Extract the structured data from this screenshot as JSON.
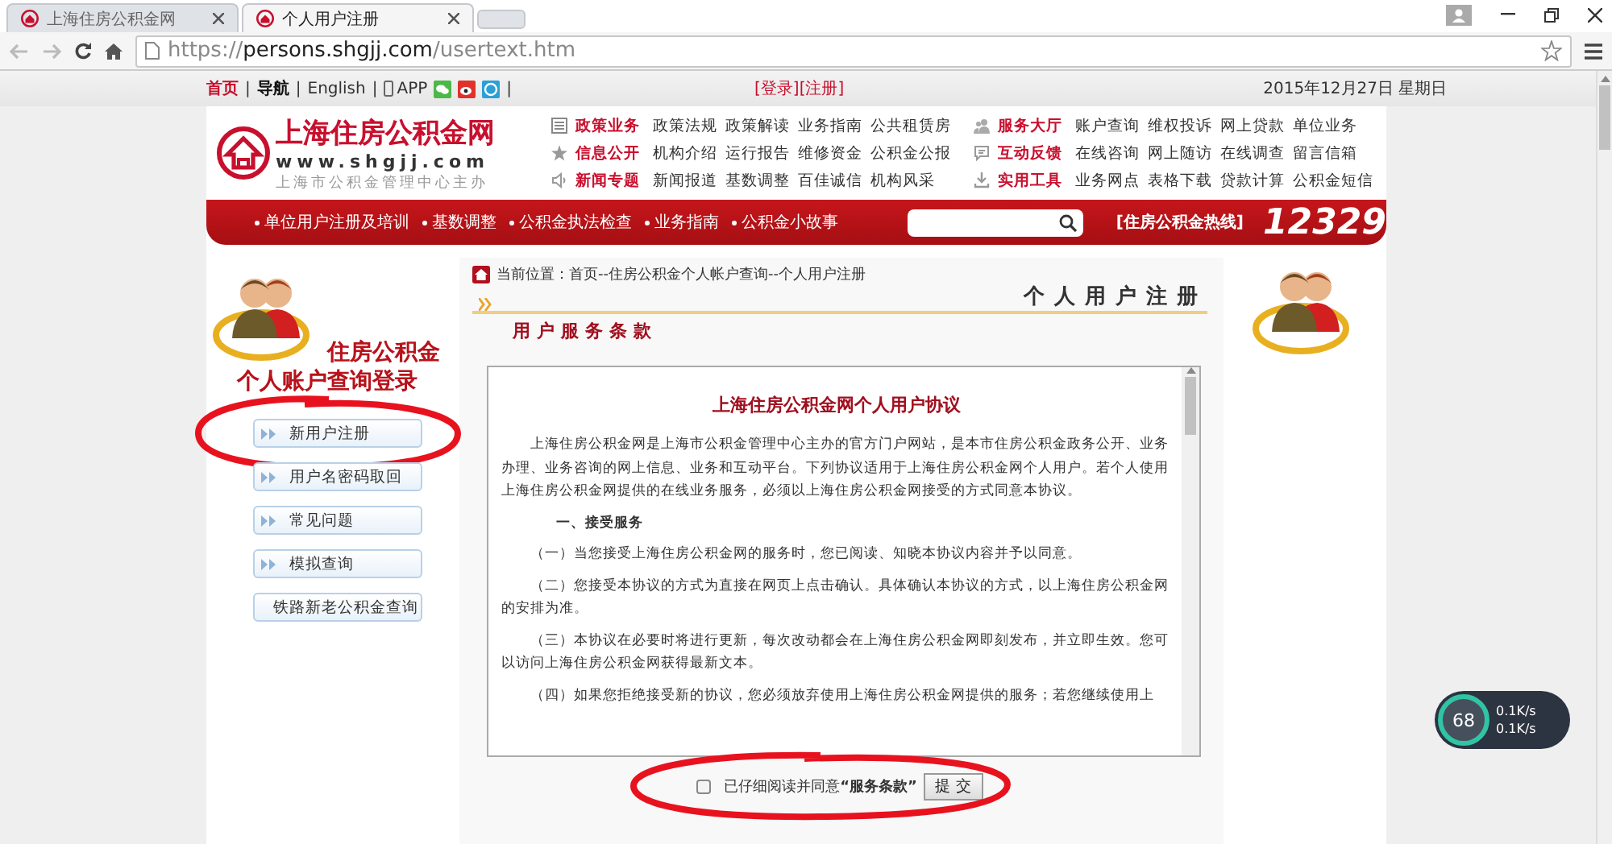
{
  "browser": {
    "tabs": [
      {
        "title": "上海住房公积金网",
        "selected": false
      },
      {
        "title": "个人用户注册",
        "selected": true
      }
    ],
    "url": {
      "scheme": "https://",
      "host": "persons.shgjj.com",
      "path": "/usertext.htm"
    }
  },
  "topbar": {
    "links": [
      {
        "label": "首页",
        "kind": "home"
      },
      {
        "label": "导航",
        "kind": "bold"
      },
      {
        "label": "English",
        "kind": "plain"
      },
      {
        "label": "APP",
        "kind": "app"
      }
    ],
    "separator": "|",
    "login": "[登录]",
    "register": "[注册]",
    "date": "2015年12月27日 星期日"
  },
  "header": {
    "logo_title": "上海住房公积金网",
    "logo_url": "www.shgjj.com",
    "logo_subtitle": "上海市公积金管理中心主办",
    "menu_columns": [
      {
        "categories": [
          {
            "label": "政策业务",
            "links": [
              "政策法规",
              "政策解读",
              "业务指南",
              "公共租赁房"
            ]
          },
          {
            "label": "信息公开",
            "links": [
              "机构介绍",
              "运行报告",
              "维修资金",
              "公积金公报"
            ]
          },
          {
            "label": "新闻专题",
            "links": [
              "新闻报道",
              "基数调整",
              "百佳诚信",
              "机构风采"
            ]
          }
        ]
      },
      {
        "categories": [
          {
            "label": "服务大厅",
            "links": [
              "账户查询",
              "维权投诉",
              "网上贷款",
              "单位业务"
            ]
          },
          {
            "label": "互动反馈",
            "links": [
              "在线咨询",
              "网上随访",
              "在线调查",
              "留言信箱"
            ]
          },
          {
            "label": "实用工具",
            "links": [
              "业务网点",
              "表格下载",
              "贷款计算",
              "公积金短信"
            ]
          }
        ]
      }
    ]
  },
  "nav": {
    "items": [
      "单位用户注册及培训",
      "基数调整",
      "公积金执法检查",
      "业务指南",
      "公积金小故事"
    ],
    "hotline_label": "[住房公积金热线]",
    "hotline_number": "12329"
  },
  "sidebar": {
    "title_lines": [
      "住房公积金",
      "个人账户查询登录"
    ],
    "buttons": [
      {
        "label": "新用户注册",
        "circled": true
      },
      {
        "label": "用户名密码取回",
        "circled": false
      },
      {
        "label": "常见问题",
        "circled": false
      },
      {
        "label": "模拟查询",
        "circled": false
      },
      {
        "label": "铁路新老公积金查询",
        "circled": false
      }
    ]
  },
  "main": {
    "breadcrumb": "当前位置：首页--住房公积金个人帐户查询--个人用户注册",
    "page_title": "个人用户注册",
    "section_title": "用户服务条款",
    "agreement": {
      "title": "上海住房公积金网个人用户协议",
      "paragraphs": [
        {
          "kind": "para",
          "text": "上海住房公积金网是上海市公积金管理中心主办的官方门户网站，是本市住房公积金政务公开、业务办理、业务咨询的网上信息、业务和互动平台。下列协议适用于上海住房公积金网个人用户。若个人使用上海住房公积金网提供的在线业务服务，必须以上海住房公积金网接受的方式同意本协议。"
        },
        {
          "kind": "heading",
          "text": "一、接受服务"
        },
        {
          "kind": "para",
          "text": "（一）当您接受上海住房公积金网的服务时，您已阅读、知晓本协议内容并予以同意。"
        },
        {
          "kind": "para",
          "text": "（二）您接受本协议的方式为直接在网页上点击确认。具体确认本协议的方式，以上海住房公积金网的安排为准。"
        },
        {
          "kind": "para",
          "text": "（三）本协议在必要时将进行更新，每次改动都会在上海住房公积金网即刻发布，并立即生效。您可以访问上海住房公积金网获得最新文本。"
        },
        {
          "kind": "para",
          "text": "（四）如果您拒绝接受新的协议，您必须放弃使用上海住房公积金网提供的服务；若您继续使用上"
        }
      ]
    },
    "agree": {
      "label_before": "已仔细阅读并同意",
      "label_terms": "“服务条款”",
      "checked": false,
      "circled": true
    },
    "submit": "提 交"
  },
  "speed_meter": {
    "value": "68",
    "upload": "0.1K/s",
    "download": "0.1K/s"
  }
}
